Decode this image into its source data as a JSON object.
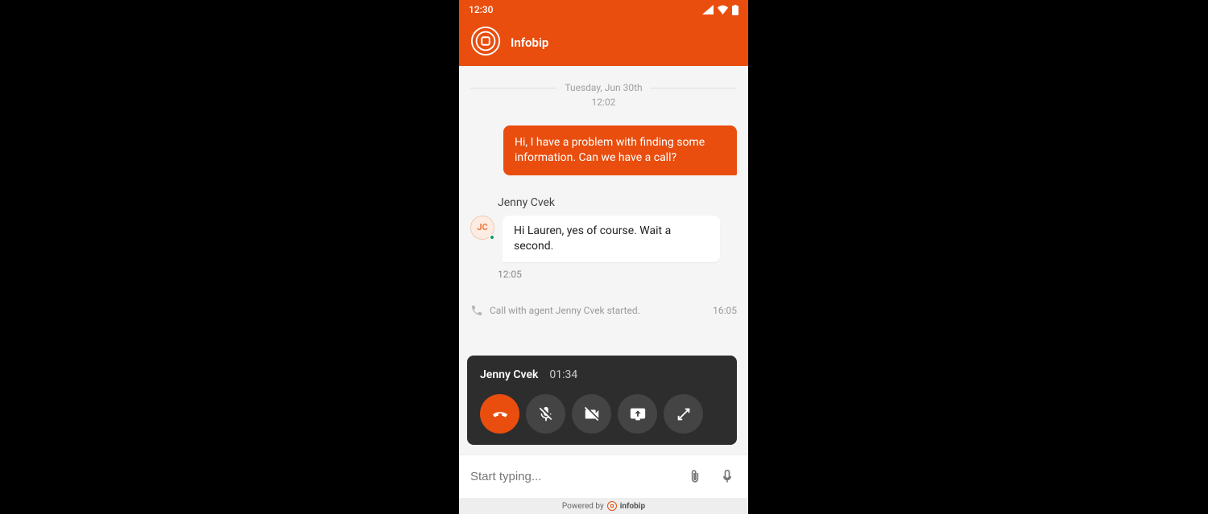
{
  "status": {
    "time": "12:30"
  },
  "header": {
    "title": "Infobip"
  },
  "thread": {
    "date": "Tuesday, Jun 30th",
    "first_time": "12:02",
    "out_msg": "Hi, I have a problem with finding some information. Can we have a call?",
    "agent_name": "Jenny Cvek",
    "avatar_initials": "JC",
    "in_msg": "Hi Lauren, yes of course. Wait a second.",
    "in_time": "12:05",
    "system_msg": "Call with agent Jenny Cvek started.",
    "system_time": "16:05"
  },
  "call": {
    "name": "Jenny Cvek",
    "timer": "01:34"
  },
  "composer": {
    "placeholder": "Start typing..."
  },
  "footer": {
    "prefix": "Powered by",
    "brand": "infobip"
  }
}
